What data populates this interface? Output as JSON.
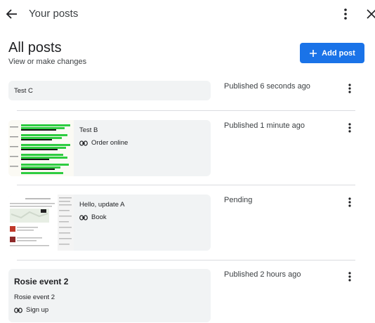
{
  "header": {
    "title": "Your posts"
  },
  "section": {
    "heading": "All posts",
    "subheading": "View or make changes"
  },
  "add_button": {
    "label": "Add post"
  },
  "posts": [
    {
      "title": "Test C",
      "status": "Published 6 seconds ago"
    },
    {
      "title": "Test B",
      "link_label": "Order online",
      "status": "Published 1 minute ago"
    },
    {
      "title": "Hello, update A",
      "link_label": "Book",
      "status": "Pending"
    },
    {
      "title": "Rosie event 2",
      "subtitle": "Rosie event 2",
      "link_label": "Sign up",
      "status": "Published 2 hours ago"
    }
  ],
  "colors": {
    "accent": "#1a73e8",
    "card_bg": "#f1f3f4",
    "chart_green": "#2ecc40"
  }
}
